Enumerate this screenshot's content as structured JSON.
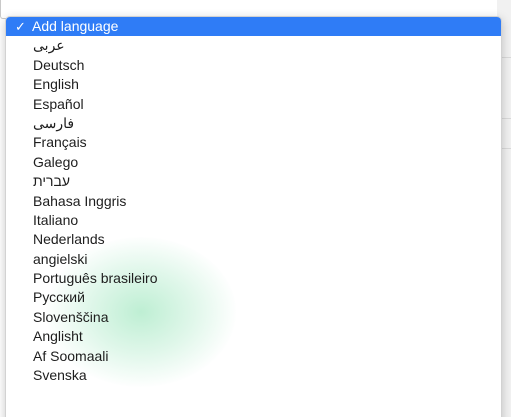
{
  "colors": {
    "selection": "#2f7cf6",
    "text": "#1d1d1d",
    "click_glow": "#28c86e"
  },
  "dropdown": {
    "selected": {
      "check_icon": "checkmark-icon",
      "check_glyph": "✓",
      "label": "Add language"
    },
    "items": [
      {
        "label": "عربى"
      },
      {
        "label": "Deutsch"
      },
      {
        "label": "English"
      },
      {
        "label": "Español"
      },
      {
        "label": "فارسی"
      },
      {
        "label": "Français"
      },
      {
        "label": "Galego"
      },
      {
        "label": "עברית"
      },
      {
        "label": "Bahasa Inggris"
      },
      {
        "label": "Italiano"
      },
      {
        "label": "Nederlands"
      },
      {
        "label": "angielski"
      },
      {
        "label": "Português brasileiro"
      },
      {
        "label": "Русский"
      },
      {
        "label": "Slovenščina"
      },
      {
        "label": "Anglisht"
      },
      {
        "label": "Af Soomaali"
      },
      {
        "label": "Svenska"
      }
    ]
  }
}
